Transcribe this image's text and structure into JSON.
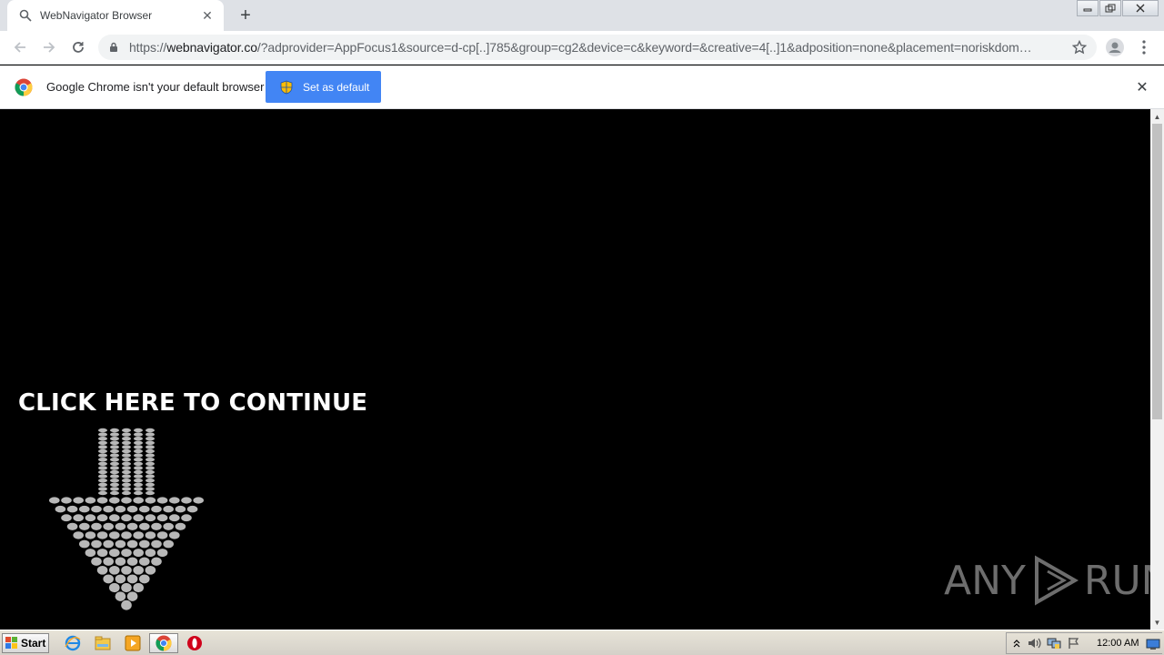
{
  "tab": {
    "title": "WebNavigator Browser",
    "icon": "search-icon",
    "close_label": "✕",
    "new_tab_label": "+"
  },
  "toolbar": {
    "url_scheme": "https://",
    "url_host": "webnavigator.co",
    "url_rest": "/?adprovider=AppFocus1&source=d-cp[..]785&group=cg2&device=c&keyword=&creative=4[..]1&adposition=none&placement=noriskdom…"
  },
  "infobar": {
    "message": "Google Chrome isn't your default browser",
    "button_label": "Set as default",
    "close_label": "✕"
  },
  "page": {
    "cta": "CLICK HERE TO CONTINUE",
    "watermark_left": "ANY",
    "watermark_right": "RUN"
  },
  "taskbar": {
    "start_label": "Start",
    "clock": "12:00 AM"
  },
  "colors": {
    "accent": "#4285f4",
    "page_bg": "#000000",
    "tab_strip": "#dee1e6"
  }
}
